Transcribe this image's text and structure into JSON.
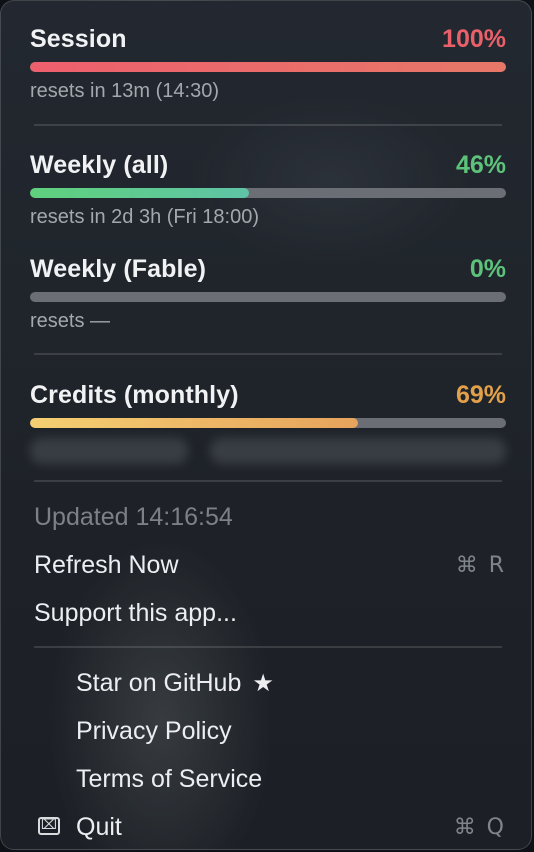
{
  "usage": [
    {
      "title": "Session",
      "percent_label": "100%",
      "percent": 100,
      "reset": "resets in 13m (14:30)",
      "color": "#e8606a",
      "bar_gradient": [
        "#ee5f6d",
        "#e77868"
      ]
    },
    {
      "title": "Weekly (all)",
      "percent_label": "46%",
      "percent": 46,
      "reset": "resets in 2d 3h (Fri 18:00)",
      "color": "#5dc27a",
      "bar_gradient": [
        "#5fd17d",
        "#5fc3a6"
      ]
    },
    {
      "title": "Weekly (Fable)",
      "percent_label": "0%",
      "percent": 0,
      "reset": "resets —",
      "color": "#5dc27a",
      "bar_gradient": [
        "#5fd17d",
        "#5fc3a6"
      ]
    }
  ],
  "credits": {
    "title": "Credits (monthly)",
    "percent_label": "69%",
    "percent": 69,
    "color": "#e2a04a",
    "bar_gradient": [
      "#f5cf72",
      "#e6a35c"
    ]
  },
  "menu": {
    "updated": "Updated 14:16:54",
    "refresh": {
      "label": "Refresh Now",
      "shortcut": "⌘ R"
    },
    "support": {
      "label": "Support this app..."
    },
    "star_github": {
      "label": "Star on GitHub",
      "icon": "★"
    },
    "privacy": {
      "label": "Privacy Policy"
    },
    "terms": {
      "label": "Terms of Service"
    },
    "quit": {
      "label": "Quit",
      "shortcut": "⌘ Q",
      "icon": "⌧"
    }
  }
}
